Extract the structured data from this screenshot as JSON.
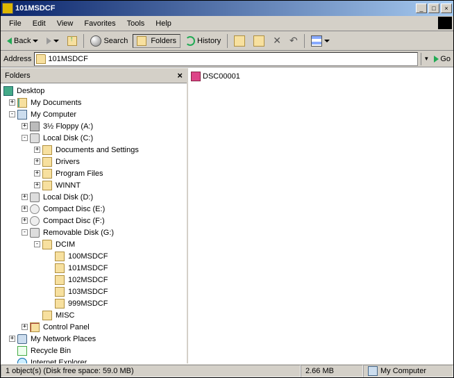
{
  "window": {
    "title": "101MSDCF"
  },
  "menus": [
    "File",
    "Edit",
    "View",
    "Favorites",
    "Tools",
    "Help"
  ],
  "toolbar": {
    "back": "Back",
    "search": "Search",
    "folders": "Folders",
    "history": "History"
  },
  "address": {
    "label": "Address",
    "value": "101MSDCF",
    "go": "Go"
  },
  "folders_pane": {
    "title": "Folders"
  },
  "tree": {
    "desktop": "Desktop",
    "mydocs": "My Documents",
    "mycomp": "My Computer",
    "floppy": "3½ Floppy (A:)",
    "c": "Local Disk (C:)",
    "docset": "Documents and Settings",
    "drivers": "Drivers",
    "progfiles": "Program Files",
    "winnt": "WINNT",
    "d": "Local Disk (D:)",
    "e": "Compact Disc (E:)",
    "f": "Compact Disc (F:)",
    "g": "Removable Disk (G:)",
    "dcim": "DCIM",
    "f100": "100MSDCF",
    "f101": "101MSDCF",
    "f102": "102MSDCF",
    "f103": "103MSDCF",
    "f999": "999MSDCF",
    "misc": "MISC",
    "cpanel": "Control Panel",
    "netplaces": "My Network Places",
    "recycle": "Recycle Bin",
    "ie": "Internet Explorer"
  },
  "contents": {
    "items": [
      "DSC00001"
    ]
  },
  "status": {
    "left": "1 object(s) (Disk free space: 59.0 MB)",
    "size": "2.66 MB",
    "location": "My Computer"
  }
}
